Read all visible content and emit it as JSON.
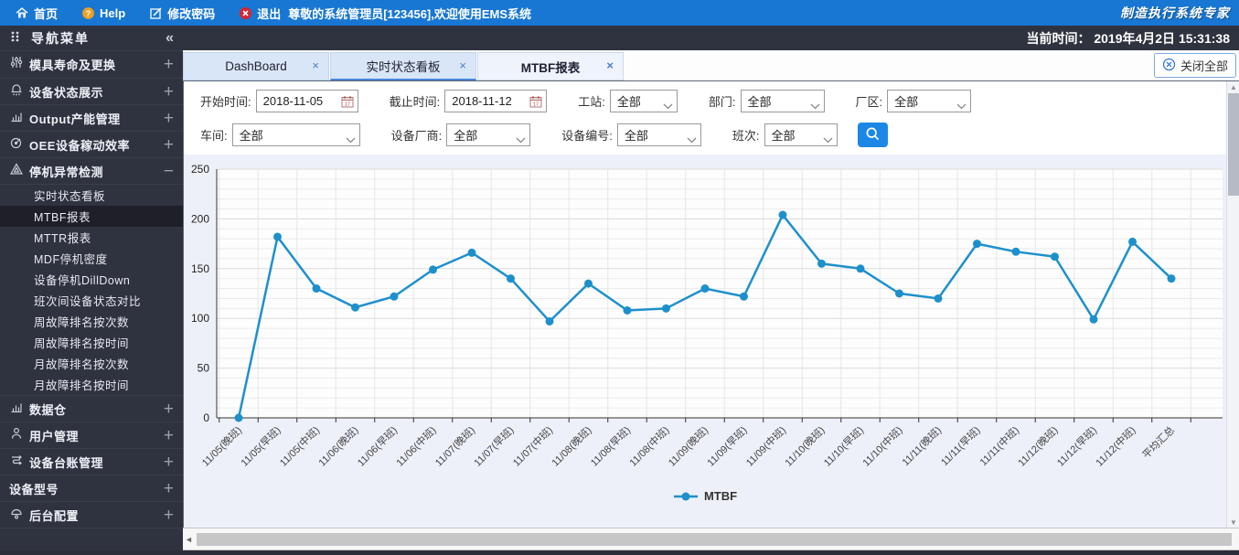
{
  "topbar": {
    "items": [
      {
        "id": "home",
        "label": "首页",
        "icon": "home-icon"
      },
      {
        "id": "help",
        "label": "Help",
        "icon": "help-icon"
      },
      {
        "id": "change-password",
        "label": "修改密码",
        "icon": "edit-icon"
      },
      {
        "id": "logout",
        "label": "退出",
        "icon": "logout-icon"
      }
    ],
    "greeting": "尊敬的系统管理员[123456],欢迎使用EMS系统",
    "brand": "制造执行系统专家"
  },
  "timebar": {
    "label": "当前时间：",
    "value": "2019年4月2日 15:31:38"
  },
  "sidebar": {
    "title": "导航菜单",
    "collapse_glyph": "«",
    "groups": [
      {
        "id": "mold-life",
        "label": "模具寿命及更换",
        "icon": "sliders-icon",
        "expand": "+"
      },
      {
        "id": "device-status",
        "label": "设备状态展示",
        "icon": "device-status-icon",
        "expand": "+"
      },
      {
        "id": "output",
        "label": "Output产能管理",
        "icon": "bar-chart-icon",
        "expand": "+"
      },
      {
        "id": "oee",
        "label": "OEE设备稼动效率",
        "icon": "gauge-icon",
        "expand": "+"
      },
      {
        "id": "downtime",
        "label": "停机异常检测",
        "icon": "warning-icon",
        "expand": "−",
        "children": [
          {
            "id": "realtime-board",
            "label": "实时状态看板",
            "active": false
          },
          {
            "id": "mtbf-report",
            "label": "MTBF报表",
            "active": true
          },
          {
            "id": "mttr-report",
            "label": "MTTR报表",
            "active": false
          },
          {
            "id": "mdf-density",
            "label": "MDF停机密度",
            "active": false
          },
          {
            "id": "drilldown",
            "label": "设备停机DillDown",
            "active": false
          },
          {
            "id": "shift-compare",
            "label": "班次间设备状态对比",
            "active": false
          },
          {
            "id": "week-fault-count",
            "label": "周故障排名按次数",
            "active": false
          },
          {
            "id": "week-fault-time",
            "label": "周故障排名按时间",
            "active": false
          },
          {
            "id": "month-fault-count",
            "label": "月故障排名按次数",
            "active": false
          },
          {
            "id": "month-fault-time",
            "label": "月故障排名按时间",
            "active": false
          }
        ]
      },
      {
        "id": "data-warehouse",
        "label": "数据仓",
        "icon": "bar-chart-icon",
        "expand": "+"
      },
      {
        "id": "user-mgmt",
        "label": "用户管理",
        "icon": "user-icon",
        "expand": "+"
      },
      {
        "id": "device-ledger",
        "label": "设备台账管理",
        "icon": "ledger-icon",
        "expand": "+"
      },
      {
        "id": "device-model",
        "label": "设备型号",
        "icon": null,
        "expand": "+"
      },
      {
        "id": "backend-config",
        "label": "后台配置",
        "icon": "config-icon",
        "expand": "+"
      }
    ]
  },
  "tabs": {
    "items": [
      {
        "id": "dashboard",
        "label": "DashBoard",
        "active": false,
        "underlined": false
      },
      {
        "id": "realtime-board",
        "label": "实时状态看板",
        "active": false,
        "underlined": true
      },
      {
        "id": "mtbf-report",
        "label": "MTBF报表",
        "active": true,
        "underlined": false
      }
    ],
    "close_glyph": "×",
    "close_all": "关闭全部"
  },
  "filters": {
    "row1": [
      {
        "id": "start-time",
        "label": "开始时间:",
        "type": "date",
        "value": "2018-11-05"
      },
      {
        "id": "end-time",
        "label": "截止时间:",
        "type": "date",
        "value": "2018-11-12"
      },
      {
        "id": "station",
        "label": "工站:",
        "type": "select",
        "value": "全部"
      },
      {
        "id": "department",
        "label": "部门:",
        "type": "select",
        "value": "全部"
      },
      {
        "id": "factory",
        "label": "厂区:",
        "type": "select",
        "value": "全部"
      }
    ],
    "row2": [
      {
        "id": "workshop",
        "label": "车间:",
        "type": "select",
        "value": "全部"
      },
      {
        "id": "vendor",
        "label": "设备厂商:",
        "type": "select",
        "value": "全部"
      },
      {
        "id": "device-no",
        "label": "设备编号:",
        "type": "select",
        "value": "全部"
      },
      {
        "id": "shift",
        "label": "班次:",
        "type": "select",
        "value": "全部"
      }
    ]
  },
  "colors": {
    "topbar_bg": "#1877d2",
    "sidebar_bg": "#2f323f",
    "accent_blue": "#1c87e5",
    "line_color": "#1d90cc"
  },
  "chart_data": {
    "type": "line",
    "title": "",
    "xlabel": "",
    "ylabel": "",
    "ylim": [
      0,
      250
    ],
    "yticks": [
      0,
      50,
      100,
      150,
      200,
      250
    ],
    "grid": true,
    "legend_position": "bottom",
    "categories": [
      "11/05(晚班)",
      "11/05(早班)",
      "11/05(中班)",
      "11/06(晚班)",
      "11/06(早班)",
      "11/06(中班)",
      "11/07(晚班)",
      "11/07(早班)",
      "11/07(中班)",
      "11/08(晚班)",
      "11/08(早班)",
      "11/08(中班)",
      "11/09(晚班)",
      "11/09(早班)",
      "11/09(中班)",
      "11/10(晚班)",
      "11/10(早班)",
      "11/10(中班)",
      "11/11(晚班)",
      "11/11(早班)",
      "11/11(中班)",
      "11/12(晚班)",
      "11/12(早班)",
      "11/12(中班)",
      "平均汇总"
    ],
    "series": [
      {
        "name": "MTBF",
        "color": "#1d90cc",
        "values": [
          0,
          182,
          130,
          111,
          122,
          149,
          166,
          140,
          97,
          135,
          108,
          110,
          130,
          122,
          204,
          155,
          150,
          125,
          120,
          175,
          167,
          162,
          99,
          177,
          140
        ]
      }
    ]
  }
}
